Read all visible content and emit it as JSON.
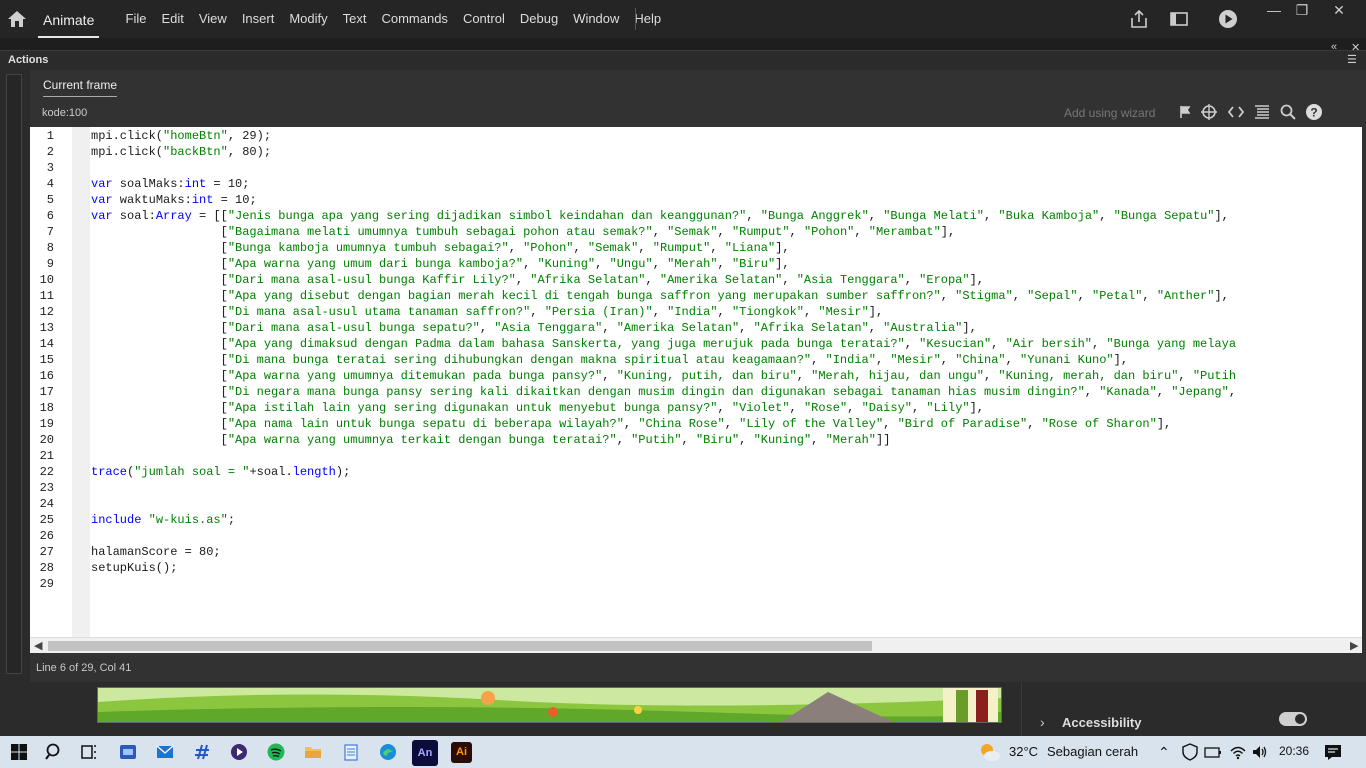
{
  "menubar": {
    "app_name": "Animate",
    "items": [
      "File",
      "Edit",
      "View",
      "Insert",
      "Modify",
      "Text",
      "Commands",
      "Control",
      "Debug",
      "Window",
      "Help"
    ],
    "icons": [
      "home-icon",
      "share-icon",
      "screen-mode-icon",
      "test-movie-icon"
    ],
    "window_controls": [
      "minimize",
      "restore",
      "close"
    ]
  },
  "actions_panel": {
    "title": "Actions",
    "tab": "Current frame",
    "frame_label": "kode:100",
    "wizard_placeholder": "Add using wizard",
    "toolbar_icons": [
      "pin-icon",
      "target-icon",
      "code-snippets-icon",
      "format-icon",
      "search-icon",
      "help-icon"
    ]
  },
  "code": {
    "lines": [
      "mpi.click(\"homeBtn\", 29);",
      "mpi.click(\"backBtn\", 80);",
      "",
      "var soalMaks:int = 10;",
      "var waktuMaks:int = 10;",
      "var soal:Array = [[\"Jenis bunga apa yang sering dijadikan simbol keindahan dan keanggunan?\", \"Bunga Anggrek\", \"Bunga Melati\", \"Buka Kamboja\", \"Bunga Sepatu\"],",
      "                  [\"Bagaimana melati umumnya tumbuh sebagai pohon atau semak?\", \"Semak\", \"Rumput\", \"Pohon\", \"Merambat\"],",
      "                  [\"Bunga kamboja umumnya tumbuh sebagai?\", \"Pohon\", \"Semak\", \"Rumput\", \"Liana\"],",
      "                  [\"Apa warna yang umum dari bunga kamboja?\", \"Kuning\", \"Ungu\", \"Merah\", \"Biru\"],",
      "                  [\"Dari mana asal-usul bunga Kaffir Lily?\", \"Afrika Selatan\", \"Amerika Selatan\", \"Asia Tenggara\", \"Eropa\"],",
      "                  [\"Apa yang disebut dengan bagian merah kecil di tengah bunga saffron yang merupakan sumber saffron?\", \"Stigma\", \"Sepal\", \"Petal\", \"Anther\"],",
      "                  [\"Di mana asal-usul utama tanaman saffron?\", \"Persia (Iran)\", \"India\", \"Tiongkok\", \"Mesir\"],",
      "                  [\"Dari mana asal-usul bunga sepatu?\", \"Asia Tenggara\", \"Amerika Selatan\", \"Afrika Selatan\", \"Australia\"],",
      "                  [\"Apa yang dimaksud dengan Padma dalam bahasa Sanskerta, yang juga merujuk pada bunga teratai?\", \"Kesucian\", \"Air bersih\", \"Bunga yang melaya",
      "                  [\"Di mana bunga teratai sering dihubungkan dengan makna spiritual atau keagamaan?\", \"India\", \"Mesir\", \"China\", \"Yunani Kuno\"],",
      "                  [\"Apa warna yang umumnya ditemukan pada bunga pansy?\", \"Kuning, putih, dan biru\", \"Merah, hijau, dan ungu\", \"Kuning, merah, dan biru\", \"Putih",
      "                  [\"Di negara mana bunga pansy sering kali dikaitkan dengan musim dingin dan digunakan sebagai tanaman hias musim dingin?\", \"Kanada\", \"Jepang\",",
      "                  [\"Apa istilah lain yang sering digunakan untuk menyebut bunga pansy?\", \"Violet\", \"Rose\", \"Daisy\", \"Lily\"],",
      "                  [\"Apa nama lain untuk bunga sepatu di beberapa wilayah?\", \"China Rose\", \"Lily of the Valley\", \"Bird of Paradise\", \"Rose of Sharon\"],",
      "                  [\"Apa warna yang umumnya terkait dengan bunga teratai?\", \"Putih\", \"Biru\", \"Kuning\", \"Merah\"]]",
      "",
      "trace(\"jumlah soal = \"+soal.length);",
      "",
      "",
      "include \"w-kuis.as\";",
      "",
      "halamanScore = 80;",
      "setupKuis();",
      ""
    ],
    "status": "Line 6 of 29, Col 41"
  },
  "properties": {
    "section": "Accessibility"
  },
  "taskbar": {
    "weather_temp": "32°C",
    "weather_text": "Sebagian cerah",
    "time": "20:36",
    "apps": [
      "start-icon",
      "search-icon",
      "task-view-icon",
      "app-icon",
      "mail-icon",
      "app-icon",
      "media-icon",
      "spotify-icon",
      "file-explorer-icon",
      "notepad-icon",
      "edge-icon",
      "animate-icon",
      "illustrator-icon"
    ]
  }
}
